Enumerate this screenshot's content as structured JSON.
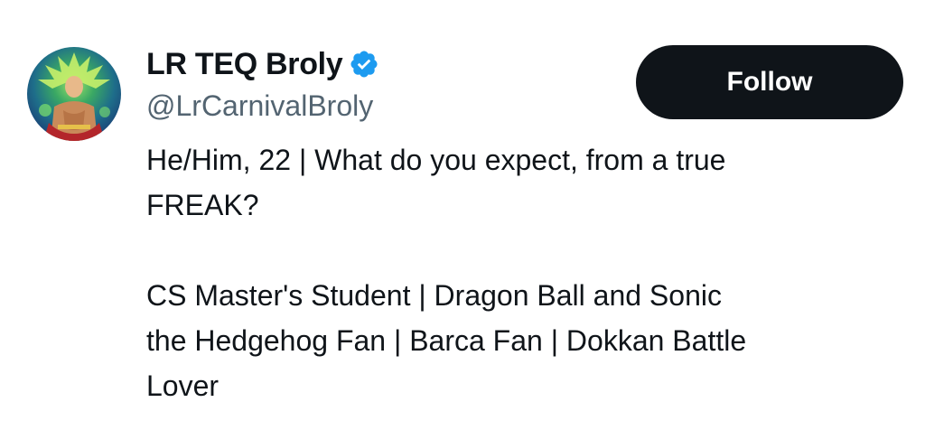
{
  "profile": {
    "display_name": "LR TEQ Broly",
    "handle": "@LrCarnivalBroly",
    "verified_icon": "verified-badge-icon",
    "avatar_icon": "avatar-image"
  },
  "actions": {
    "follow_label": "Follow"
  },
  "bio": {
    "line1": "He/Him, 22 | What do you expect, from a true",
    "line2": "FREAK?",
    "line3": "CS Master's Student | Dragon Ball and Sonic",
    "line4": "the Hedgehog Fan | Barca Fan | Dokkan Battle",
    "line5": "Lover"
  },
  "colors": {
    "text_primary": "#0f1419",
    "text_secondary": "#536471",
    "verified_blue": "#1d9bf0",
    "button_bg": "#0f1419",
    "button_text": "#ffffff",
    "background": "#ffffff"
  }
}
